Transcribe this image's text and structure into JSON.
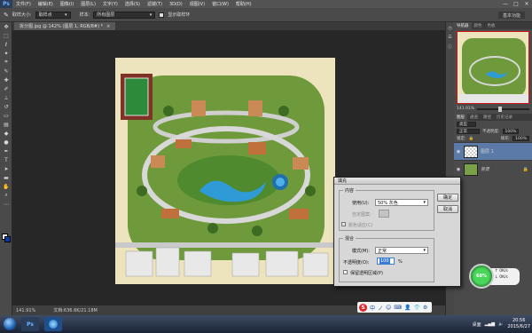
{
  "app": {
    "logo": "Ps"
  },
  "menu": [
    "文件(F)",
    "编辑(E)",
    "图像(I)",
    "图层(L)",
    "文字(Y)",
    "选择(S)",
    "滤镜(T)",
    "3D(D)",
    "视图(V)",
    "窗口(W)",
    "帮助(H)"
  ],
  "window_controls": [
    "—",
    "□",
    "✕"
  ],
  "options": {
    "sample_size_label": "取样大小:",
    "sample_size_value": "取样点",
    "sample_label": "样本:",
    "sample_value": "所有图层",
    "show_ring_label": "显示取样环",
    "workspace": "基本功能"
  },
  "document": {
    "tab_title": "拆分图.jpg @ 142% (图层 1, RGB/8#) *",
    "close": "×"
  },
  "status": {
    "zoom": "141.91%",
    "doc_size": "文档:636.6K/21.18M"
  },
  "panels": {
    "top_tabs": [
      "导航器",
      "颜色",
      "色板"
    ],
    "zoom_value": "141.91%",
    "layer_tabs": [
      "图层",
      "通道",
      "路径",
      "历史记录"
    ],
    "kind_label": "类型",
    "blend_mode": "正常",
    "opacity_label": "不透明度:",
    "opacity_value": "100%",
    "lock_label": "锁定:",
    "fill_label": "填充:",
    "fill_value": "100%",
    "layers": [
      {
        "name": "图层 1",
        "selected": true
      },
      {
        "name": "背景",
        "selected": false
      }
    ]
  },
  "dialog": {
    "title": "填充",
    "content_group": "内容",
    "use_label": "使用(U):",
    "use_value": "50% 灰色",
    "custom_pattern_label": "自定图案:",
    "color_adapt_label": "颜色适应(C)",
    "blend_group": "混合",
    "mode_label": "模式(M):",
    "mode_value": "正常",
    "opacity_label": "不透明度(O):",
    "opacity_value": "100",
    "percent": "%",
    "preserve_label": "保留透明区域(P)",
    "ok": "确定",
    "cancel": "取消"
  },
  "widgets": {
    "ime_letter": "S",
    "ime_icons": [
      "中",
      "ノ",
      "☺",
      "⌨",
      "👤",
      "👕",
      "⚙"
    ],
    "net_percent": "68%",
    "net_up": "0K/s",
    "net_down": "0K/s"
  },
  "taskbar": {
    "tray_label": "桌面",
    "time": "20:56",
    "date": "2015/6/27"
  }
}
